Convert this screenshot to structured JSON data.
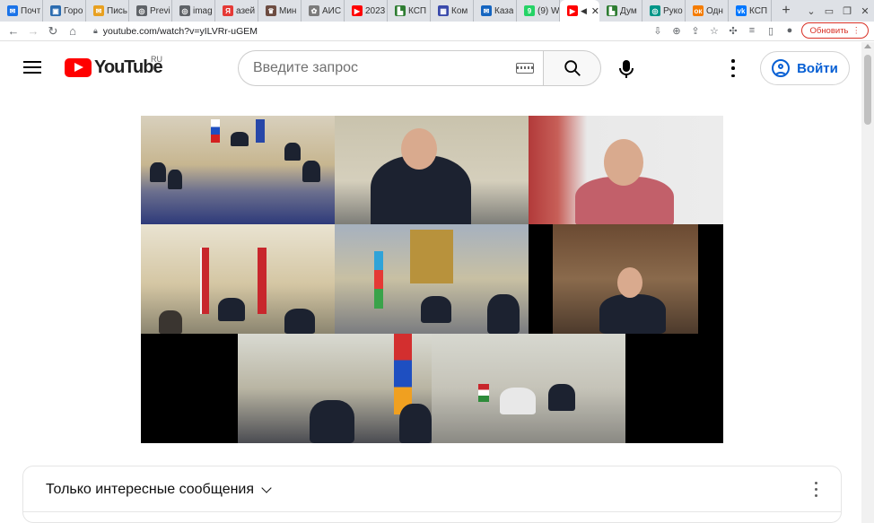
{
  "browser": {
    "tabs": [
      {
        "label": "Почт",
        "icon": "mail-icon",
        "color": "#1a73e8",
        "glyph": "✉"
      },
      {
        "label": "Горо",
        "icon": "city-icon",
        "color": "#2b6cb0",
        "glyph": "▣"
      },
      {
        "label": "Пись",
        "icon": "letter-icon",
        "color": "#e8a020",
        "glyph": "✉"
      },
      {
        "label": "Previ",
        "icon": "globe-icon",
        "color": "#5f6368",
        "glyph": "◎"
      },
      {
        "label": "imag",
        "icon": "globe-icon",
        "color": "#5f6368",
        "glyph": "◎"
      },
      {
        "label": "азей",
        "icon": "yandex-icon",
        "color": "#e53935",
        "glyph": "Я"
      },
      {
        "label": "Мин",
        "icon": "emblem-icon",
        "color": "#6d4c41",
        "glyph": "♛"
      },
      {
        "label": "АИС",
        "icon": "emblem-icon",
        "color": "#7b7b7b",
        "glyph": "✿"
      },
      {
        "label": "2023",
        "icon": "youtube-icon",
        "color": "#ff0000",
        "glyph": "▶"
      },
      {
        "label": "КСП",
        "icon": "ksp-icon",
        "color": "#2e7d32",
        "glyph": "▙"
      },
      {
        "label": "Ком",
        "icon": "com-icon",
        "color": "#3949ab",
        "glyph": "▦"
      },
      {
        "label": "Каза",
        "icon": "mail-icon",
        "color": "#1565c0",
        "glyph": "✉"
      },
      {
        "label": "(9) W",
        "icon": "whatsapp-icon",
        "color": "#25d366",
        "glyph": "9"
      },
      {
        "label": "Дум",
        "icon": "duma-icon",
        "color": "#2e7d32",
        "glyph": "▙"
      },
      {
        "label": "Руко",
        "icon": "globe-icon",
        "color": "#009688",
        "glyph": "◎"
      },
      {
        "label": "Одн",
        "icon": "ok-icon",
        "color": "#f57c00",
        "glyph": "ок"
      },
      {
        "label": "КСП",
        "icon": "vk-icon",
        "color": "#0077ff",
        "glyph": "vk"
      }
    ],
    "active_tab_close": "✕",
    "new_tab": "+",
    "url": "youtube.com/watch?v=yILVRr-uGEM",
    "update_button": "Обновить"
  },
  "youtube": {
    "logo_text": "YouTube",
    "region": "RU",
    "search_placeholder": "Введите запрос",
    "signin_label": "Войти"
  },
  "comments": {
    "title": "Только интересные сообщения"
  }
}
